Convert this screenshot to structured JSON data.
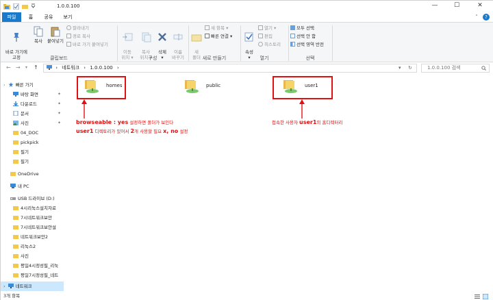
{
  "window": {
    "title": "1.0.0.100",
    "controls": {
      "minimize": "—",
      "maximize": "☐",
      "close": "✕"
    }
  },
  "ribbon_tabs": [
    "파일",
    "홈",
    "공유",
    "보기"
  ],
  "help_label": "?",
  "ribbon": {
    "clipboard": {
      "pin_label": "바로 가기에\n고정",
      "copy_label": "복사",
      "paste_label": "붙여넣기",
      "cut_label": "잘라내기",
      "copy_path_label": "경로 복사",
      "paste_shortcut_label": "바로 가기 붙여넣기",
      "group_label": "클립보드"
    },
    "organize": {
      "move_label": "이동\n위치 ▾",
      "copyto_label": "복사\n위치 ▾",
      "delete_label": "삭제\n▾",
      "rename_label": "이름\n바꾸기",
      "group_label": "구성"
    },
    "new": {
      "new_folder_label": "새\n폴더",
      "new_item_label": "새 항목 ▾",
      "easy_access_label": "빠른 연결 ▾",
      "group_label": "새로 만들기"
    },
    "open": {
      "properties_label": "속성\n▾",
      "open_label": "열기 ▾",
      "edit_label": "편집",
      "history_label": "히스토리",
      "group_label": "열기"
    },
    "select": {
      "select_all_label": "모두 선택",
      "select_none_label": "선택 안 함",
      "invert_label": "선택 영역 반전",
      "group_label": "선택"
    }
  },
  "address": {
    "back": "←",
    "forward": "→",
    "recent": "▾",
    "up": "↑",
    "crumbs": [
      "›",
      "네트워크",
      "›",
      "1.0.0.100",
      "›"
    ],
    "dropdown": "▾",
    "refresh": "↻",
    "search_placeholder": "1.0.0.100 검색",
    "search_icon": "search-icon"
  },
  "nav": {
    "quick_access": "빠른 가기",
    "items": [
      {
        "label": "바탕 화면",
        "pinned": true,
        "icon": "desktop-icon"
      },
      {
        "label": "다운로드",
        "pinned": true,
        "icon": "download-icon"
      },
      {
        "label": "문서",
        "pinned": true,
        "icon": "document-icon"
      },
      {
        "label": "사진",
        "pinned": true,
        "icon": "picture-icon"
      },
      {
        "label": "04_DOC",
        "pinned": false,
        "icon": "folder-icon"
      },
      {
        "label": "pickpick",
        "pinned": false,
        "icon": "folder-icon"
      },
      {
        "label": "필기",
        "pinned": false,
        "icon": "folder-icon"
      },
      {
        "label": "필기",
        "pinned": false,
        "icon": "folder-icon"
      }
    ],
    "onedrive": "OneDrive",
    "this_pc": "내 PC",
    "usb": "USB 드라이브 (D:)",
    "usb_items": [
      "4시리눅스설치자료",
      "7시네트워크보안",
      "7시네트워크보안설",
      "네트워크보안2",
      "리눅스2",
      "사진",
      "평일4시정성필_리눅",
      "평일7시정성필_네트"
    ],
    "network": "네트워크",
    "pin_glyph": "📌"
  },
  "folders": [
    {
      "name": "homes",
      "icon": "network-share-folder-icon"
    },
    {
      "name": "public",
      "icon": "network-share-folder-icon"
    },
    {
      "name": "user1",
      "icon": "network-share-folder-icon"
    }
  ],
  "annotations": {
    "left_line1_bold": "browseable : yes",
    "left_line1_rest": " 설정하면 폴더가 보인다",
    "left_line2_bold1": "user1",
    "left_line2_mid": " 디렉토리가 있어서 ",
    "left_line2_bold2": "2",
    "left_line2_mid2": "개 사용할 필요 ",
    "left_line2_bold3": "x, no",
    "left_line2_end": " 설정",
    "right_pre": "접속한 사용자 ",
    "right_bold": "user1",
    "right_post": "의 홈디렉터리",
    "color": "#e01010"
  },
  "status": {
    "count": "3개 항목",
    "view_details_icon": "details-view-icon",
    "view_large_icon": "large-icons-view-icon"
  }
}
